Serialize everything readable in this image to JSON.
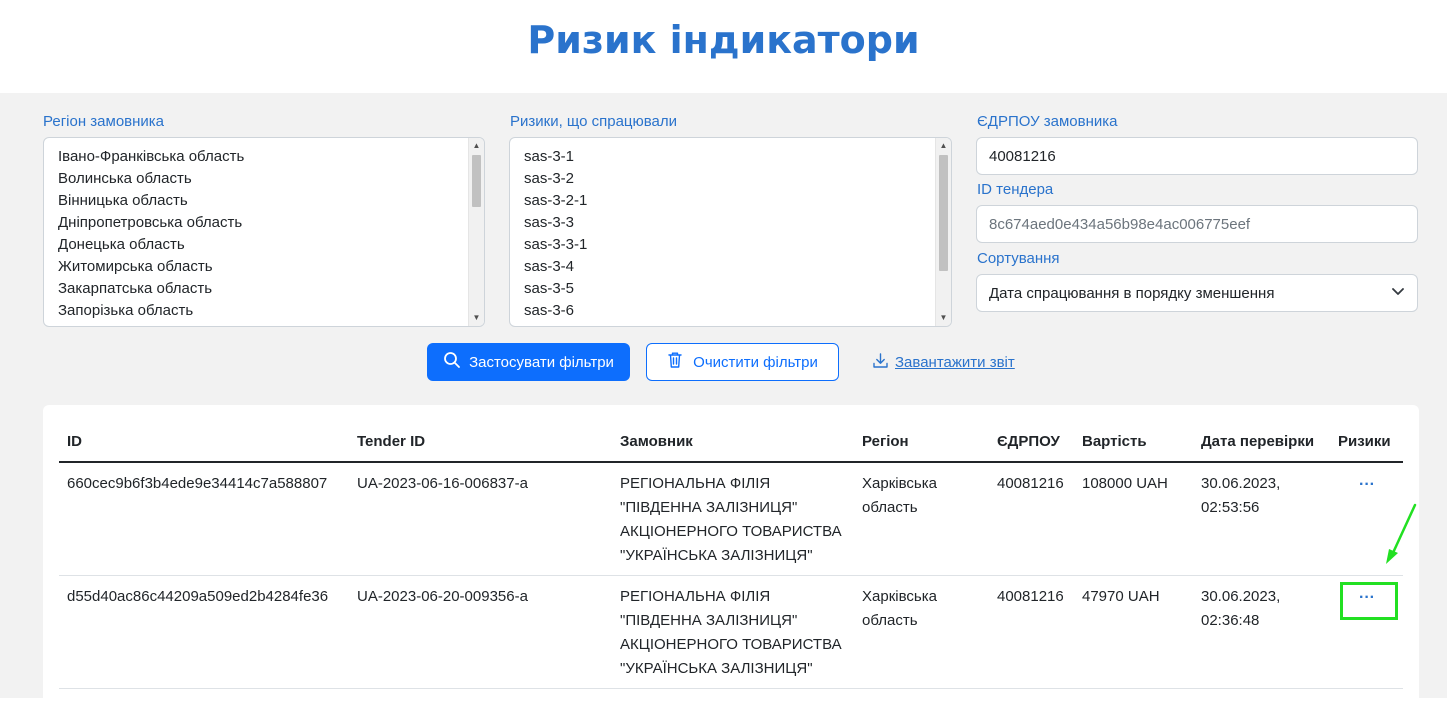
{
  "page": {
    "title": "Ризик індикатори"
  },
  "filters": {
    "region": {
      "label": "Регіон замовника",
      "options": [
        "Івано-Франківська область",
        "Волинська область",
        "Вінницька область",
        "Дніпропетровська область",
        "Донецька область",
        "Житомирська область",
        "Закарпатська область",
        "Запорізька область"
      ]
    },
    "risks": {
      "label": "Ризики, що спрацювали",
      "options": [
        "sas-3-1",
        "sas-3-2",
        "sas-3-2-1",
        "sas-3-3",
        "sas-3-3-1",
        "sas-3-4",
        "sas-3-5",
        "sas-3-6"
      ]
    },
    "edrpou": {
      "label": "ЄДРПОУ замовника",
      "value": "40081216"
    },
    "tender_id": {
      "label": "ID тендера",
      "placeholder": "8c674aed0e434a56b98e4ac006775eef"
    },
    "sort": {
      "label": "Сортування",
      "selected": "Дата спрацювання в порядку зменшення"
    }
  },
  "actions": {
    "apply": "Застосувати фільтри",
    "clear": "Очистити фільтри",
    "download": "Завантажити звіт"
  },
  "table": {
    "columns": [
      "ID",
      "Tender ID",
      "Замовник",
      "Регіон",
      "ЄДРПОУ",
      "Вартість",
      "Дата перевірки",
      "Ризики"
    ],
    "rows": [
      {
        "id": "660cec9b6f3b4ede9e34414c7a588807",
        "tender_id": "UA-2023-06-16-006837-a",
        "customer": [
          "РЕГІОНАЛЬНА ФІЛІЯ",
          "\"ПІВДЕННА ЗАЛІЗНИЦЯ\"",
          "АКЦІОНЕРНОГО ТОВАРИСТВА",
          "\"УКРАЇНСЬКА ЗАЛІЗНИЦЯ\""
        ],
        "region": [
          "Харківська",
          "область"
        ],
        "edrpou": "40081216",
        "cost": "108000 UAH",
        "date": [
          "30.06.2023,",
          "02:53:56"
        ],
        "risks_action": "···"
      },
      {
        "id": "d55d40ac86c44209a509ed2b4284fe36",
        "tender_id": "UA-2023-06-20-009356-a",
        "customer": [
          "РЕГІОНАЛЬНА ФІЛІЯ",
          "\"ПІВДЕННА ЗАЛІЗНИЦЯ\"",
          "АКЦІОНЕРНОГО ТОВАРИСТВА",
          "\"УКРАЇНСЬКА ЗАЛІЗНИЦЯ\""
        ],
        "region": [
          "Харківська",
          "область"
        ],
        "edrpou": "40081216",
        "cost": "47970 UAH",
        "date": [
          "30.06.2023,",
          "02:36:48"
        ],
        "risks_action": "···"
      }
    ]
  },
  "icons": {
    "apply": "search-icon",
    "clear": "trash-icon",
    "download": "download-icon",
    "sort": "chevron-down-icon",
    "annotation": "arrow-icon"
  },
  "colors": {
    "title": "#2a73cc",
    "primary": "#0d6efd",
    "panel_bg": "#f2f2f2",
    "highlight": "#22e022"
  }
}
